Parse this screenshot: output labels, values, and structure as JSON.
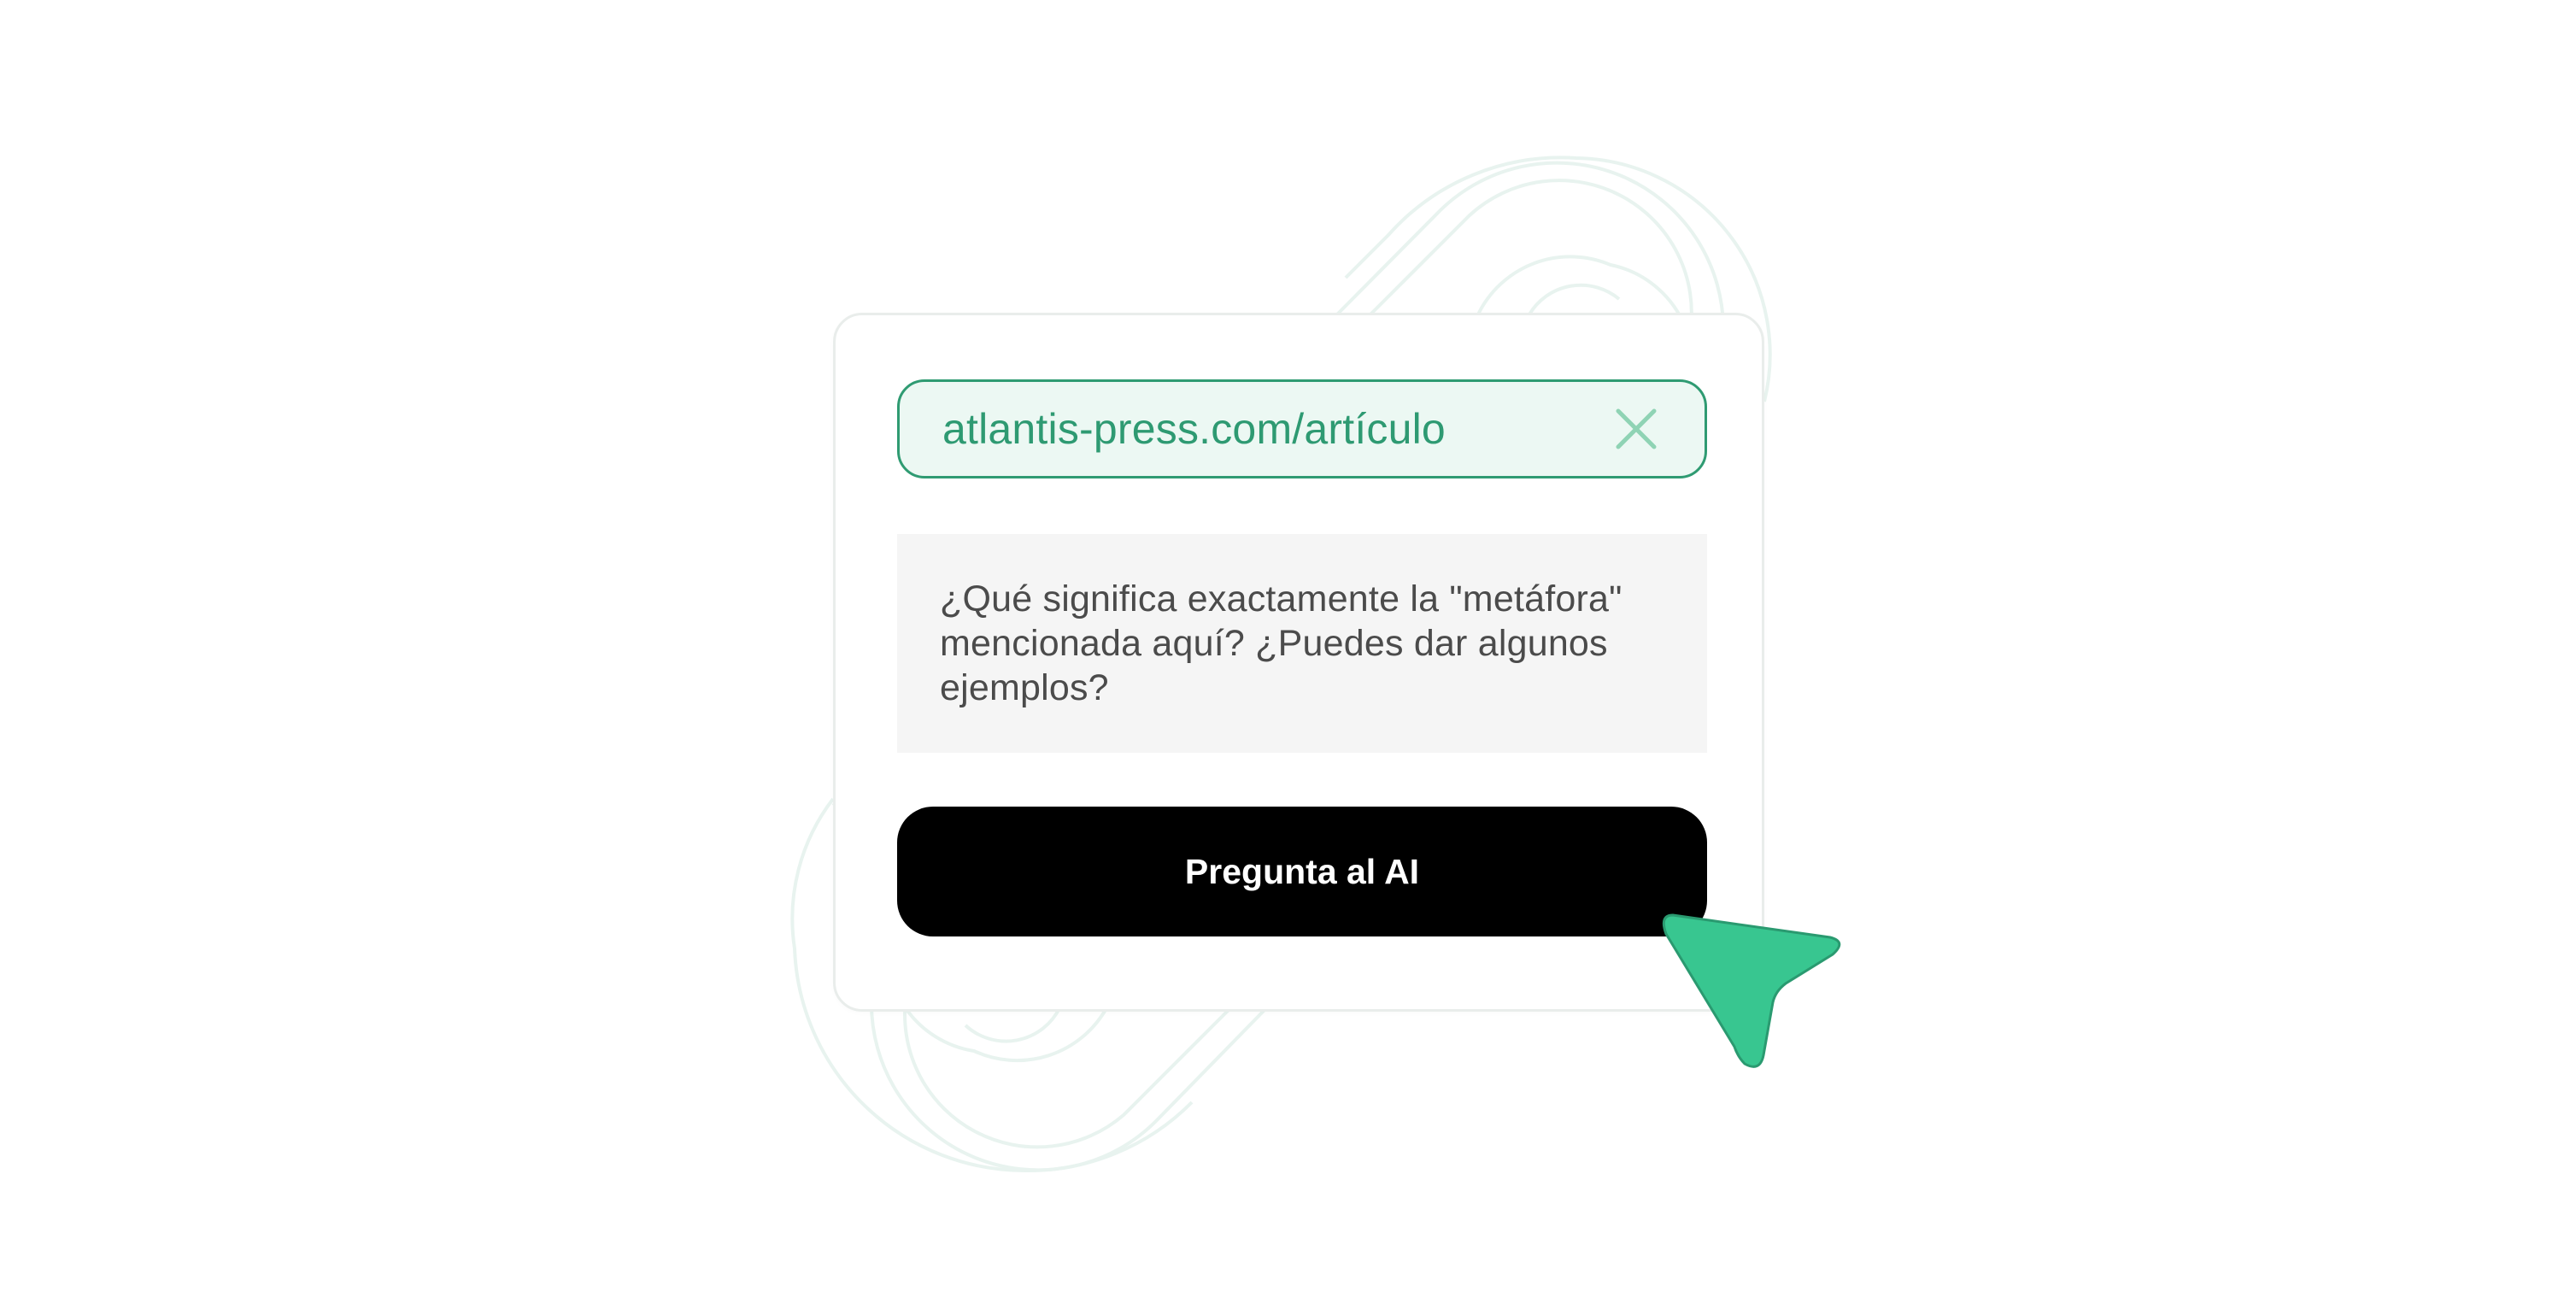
{
  "url_field": {
    "value": "atlantis-press.com/artículo",
    "clear_icon": "close-icon"
  },
  "question": {
    "text": "¿Qué significa exactamente la \"metáfora\" mencionada aquí? ¿Puedes dar algunos ejemplos?"
  },
  "ask_button": {
    "label": "Pregunta al AI"
  },
  "pointer": {
    "icon": "cursor-arrow-icon"
  },
  "colors": {
    "accent": "#2f9b72",
    "accent_light": "#ecf8f3",
    "cursor_fill": "#38c690",
    "button_bg": "#000000",
    "question_bg": "#f5f5f5"
  }
}
